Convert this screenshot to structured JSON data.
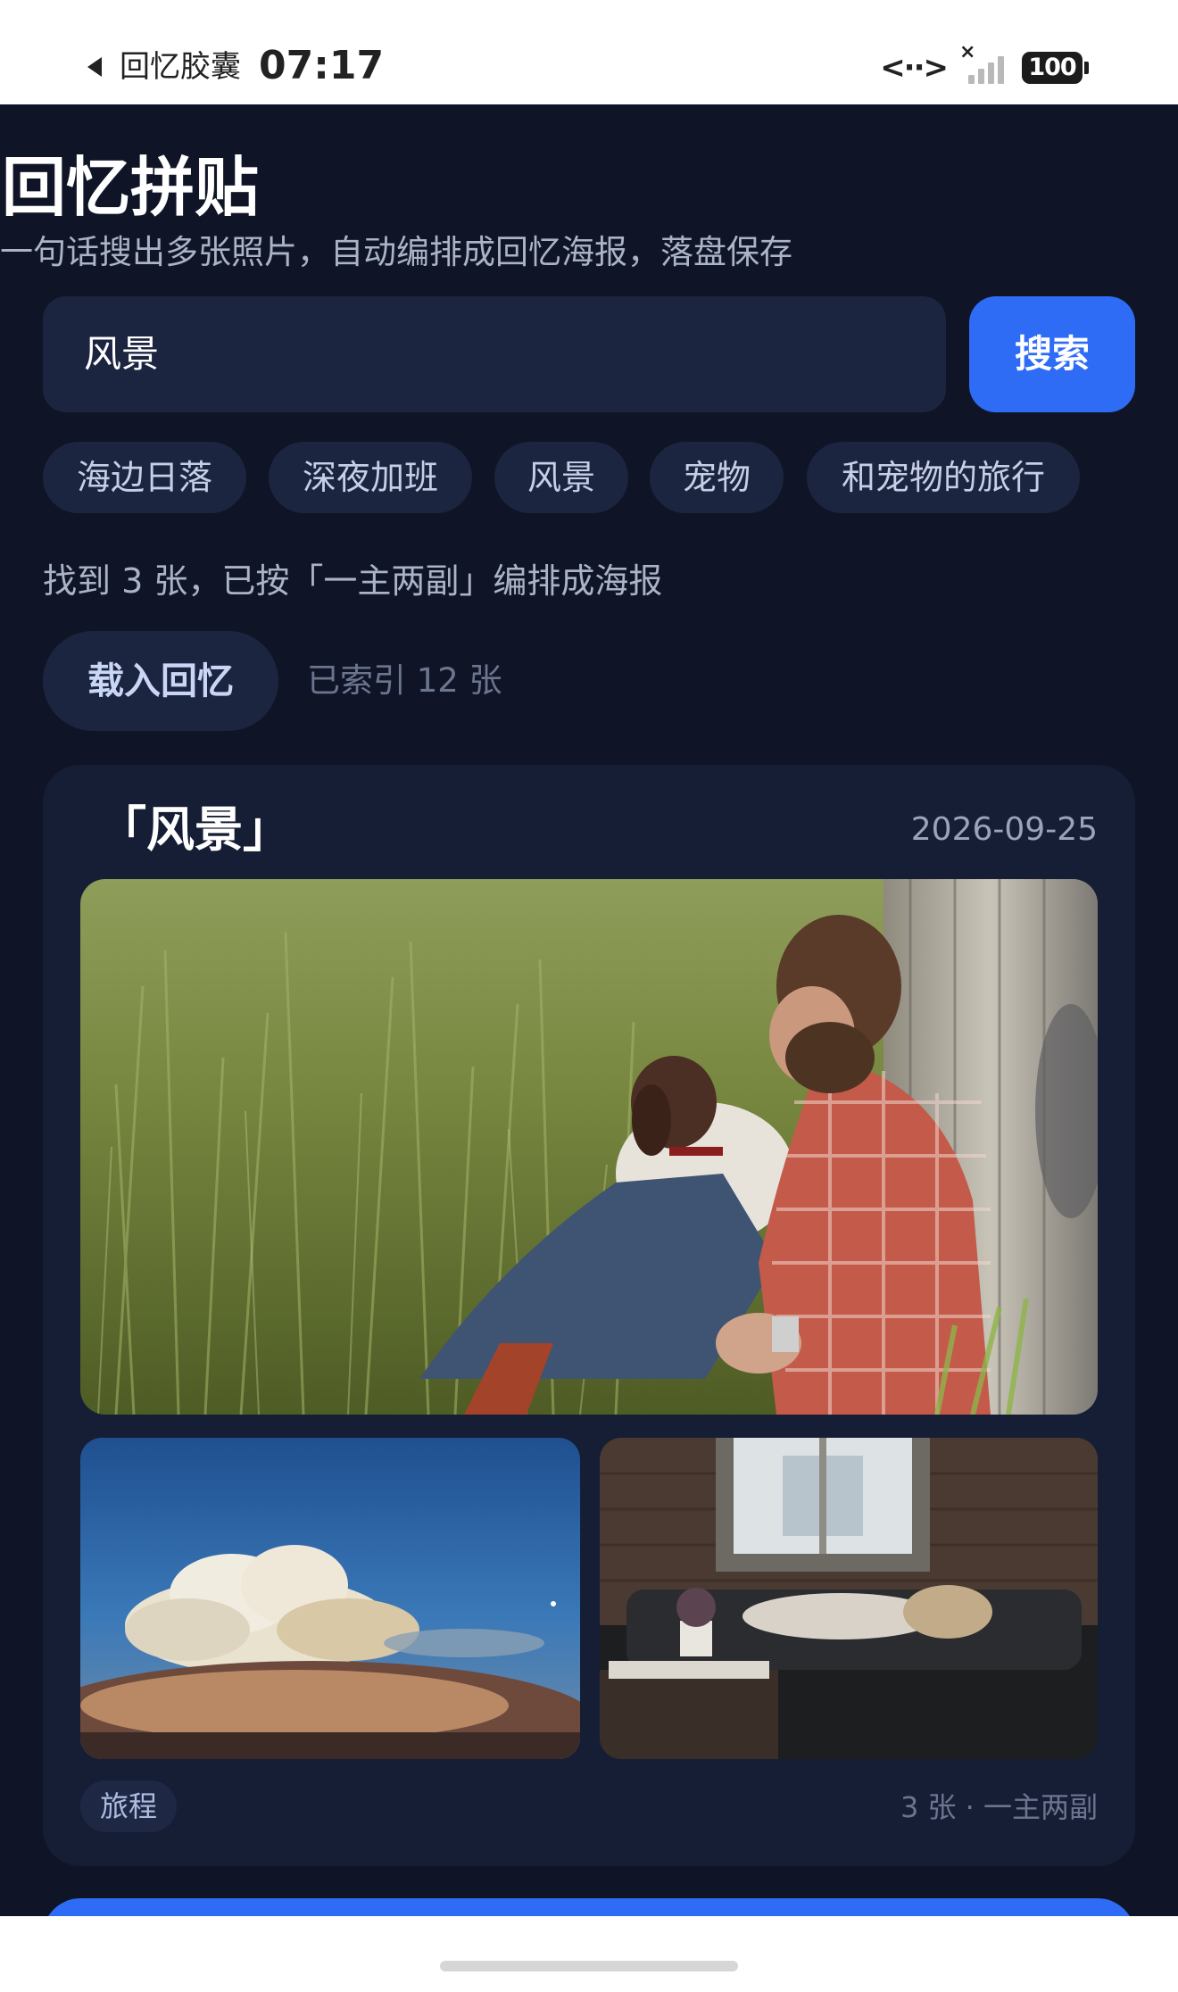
{
  "status_bar": {
    "back_app_label": "回忆胶囊",
    "time": "07:17",
    "network_indicator": "<··>",
    "signal_x": "×",
    "battery": "100"
  },
  "header": {
    "title": "回忆拼贴",
    "subtitle": "一句话搜出多张照片，自动编排成回忆海报，落盘保存"
  },
  "search": {
    "value": "风景",
    "button_label": "搜索"
  },
  "suggestions": [
    "海边日落",
    "深夜加班",
    "风景",
    "宠物",
    "和宠物的旅行"
  ],
  "result_summary": "找到 3 张，已按「一主两副」编排成海报",
  "load_button_label": "载入回忆",
  "indexed_count": "已索引 12 张",
  "poster": {
    "title": "「风景」",
    "date": "2026-09-25",
    "photos": [
      {
        "role": "main",
        "description_icon": "man-with-dog-in-grass-photo"
      },
      {
        "role": "sub",
        "description_icon": "clouds-sky-photo"
      },
      {
        "role": "sub",
        "description_icon": "person-on-sofa-photo"
      }
    ],
    "tag": "旅程",
    "meta": "3 张 · 一主两副"
  },
  "colors": {
    "background": "#0f1526",
    "card": "#161e35",
    "field": "#1c2540",
    "accent": "#2f6cf6"
  }
}
